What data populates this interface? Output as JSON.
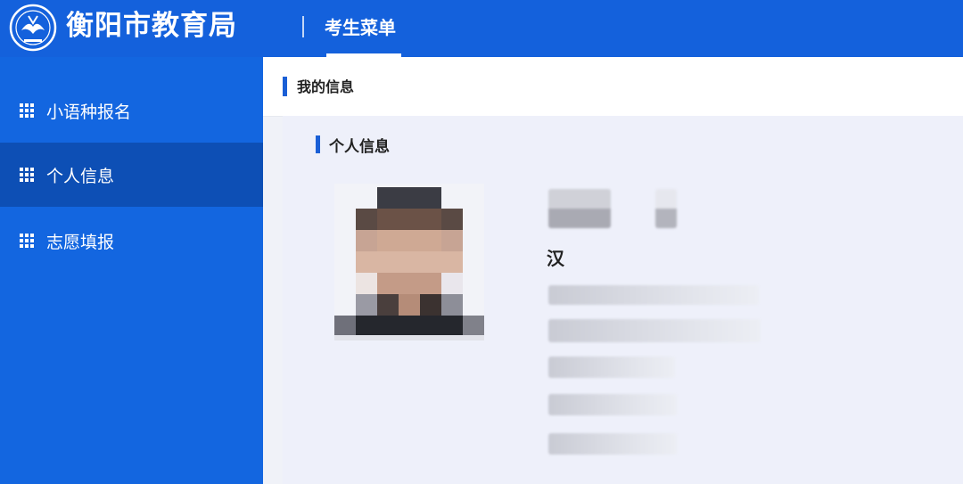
{
  "header": {
    "brand": "衡阳市教育局",
    "menu_title": "考生菜单",
    "logo_icon": "education-bureau-logo",
    "color": "#1461dc"
  },
  "sidebar": {
    "items": [
      {
        "label": "小语种报名",
        "icon": "grid-icon",
        "active": false
      },
      {
        "label": "个人信息",
        "icon": "grid-icon",
        "active": true
      },
      {
        "label": "志愿填报",
        "icon": "grid-icon",
        "active": false
      }
    ],
    "active_color": "#0d4fb5"
  },
  "main": {
    "page_title": "我的信息",
    "section_title": "个人信息",
    "ethnicity": "汉",
    "photo": "blurred-student-photo"
  }
}
